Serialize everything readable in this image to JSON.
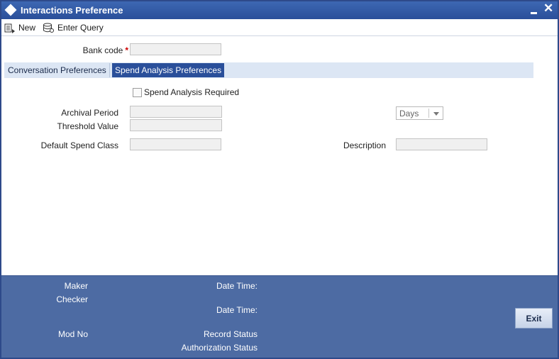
{
  "window": {
    "title": "Interactions Preference"
  },
  "toolbar": {
    "new_label": "New",
    "enter_query_label": "Enter Query"
  },
  "form": {
    "bank_code_label": "Bank code",
    "required_mark": "*",
    "bank_code_value": ""
  },
  "tabs": [
    {
      "label": "Conversation Preferences",
      "active": false
    },
    {
      "label": "Spend Analysis Preferences",
      "active": true
    }
  ],
  "spend": {
    "required_label": "Spend Analysis Required",
    "required_checked": false,
    "archival_period_label": "Archival Period",
    "archival_period_value": "",
    "archival_unit": "Days",
    "threshold_label": "Threshold Value",
    "threshold_value": "",
    "default_class_label": "Default Spend Class",
    "default_class_value": "",
    "description_label": "Description",
    "description_value": ""
  },
  "footer": {
    "maker_label": "Maker",
    "checker_label": "Checker",
    "mod_no_label": "Mod No",
    "date_time_label_1": "Date Time:",
    "date_time_label_2": "Date Time:",
    "record_status_label": "Record Status",
    "authorization_status_label": "Authorization Status",
    "exit_label": "Exit"
  },
  "colors": {
    "titlebar": "#2a4f9a",
    "active_tab": "#2a4f9a",
    "tab_strip": "#dce6f4",
    "footer": "#4d6ba3",
    "required": "#cc0000"
  }
}
